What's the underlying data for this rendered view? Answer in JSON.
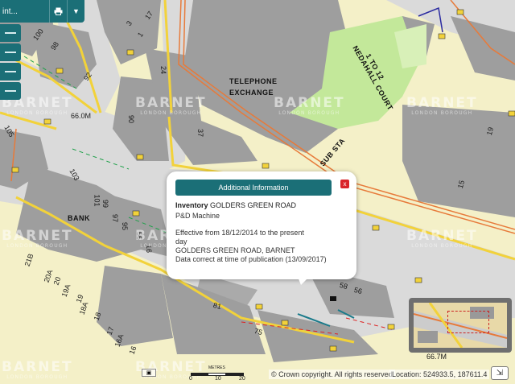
{
  "toolbar": {
    "label": "int...",
    "print_icon": "print-icon",
    "menu_icon": "caret-down-icon"
  },
  "popup": {
    "header": "Additional Information",
    "title_prefix": "Inventory",
    "title_name": "GOLDERS GREEN ROAD",
    "subtitle": "P&D Machine",
    "effective": "Effective from 18/12/2014 to the present",
    "effective_cont": "day",
    "address": "GOLDERS GREEN ROAD, BARNET",
    "data_note": "Data correct at time of publication (13/09/2017)",
    "close_label": "x"
  },
  "map_labels": {
    "telephone": "TELEPHONE",
    "exchange": "EXCHANGE",
    "nedahall": "NEDAHALL COURT",
    "one_to_12": "1 TO 12",
    "sub_sta": "SUB STA",
    "bank": "BANK",
    "elev_1": "66.0M",
    "elev_2": "66.7M",
    "n100": "100",
    "n98": "98",
    "n92": "92",
    "n1": "1",
    "n3": "3",
    "n17": "17",
    "n24": "24",
    "n37": "37",
    "n90": "90",
    "n105": "105",
    "n103": "103",
    "n101": "101",
    "n99": "99",
    "n97": "97",
    "n95": "95",
    "n56a": "56",
    "n16": "16",
    "n21b": "21B",
    "n20a": "20A",
    "n20": "20",
    "n19a": "19A",
    "n19": "19",
    "n18a": "18A",
    "n18": "18",
    "n17b": "17",
    "n16a": "16A",
    "n16b": "16",
    "n81": "81",
    "n75": "75",
    "n58": "58",
    "n56": "56",
    "n19c": "19",
    "n15": "15"
  },
  "watermark": {
    "name": "BARNET",
    "sub": "LONDON BOROUGH"
  },
  "status": {
    "copyright": "© Crown copyright. All rights reserved",
    "location": "Location: 524933.5, 187611.4",
    "scale_caption": "METRES",
    "scale_0": "0",
    "scale_10": "10",
    "scale_20": "20"
  },
  "colors": {
    "teal": "#1b6f77",
    "building": "#9e9e9e",
    "yellow_land": "#f4f0c8",
    "green": "#c3e89a",
    "road": "#dcdcdc",
    "close_red": "#d9242a"
  }
}
